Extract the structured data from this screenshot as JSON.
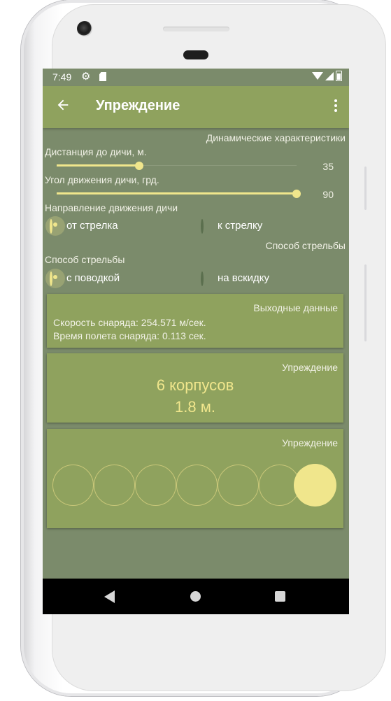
{
  "status": {
    "time": "7:49"
  },
  "appbar": {
    "title": "Упреждение"
  },
  "dynamics": {
    "caption": "Динамические характеристики",
    "distance": {
      "label": "Дистанция до дичи, м.",
      "value": "35",
      "fraction": 0.345
    },
    "angle": {
      "label": "Угол движения дичи, грд.",
      "value": "90",
      "fraction": 1.0
    }
  },
  "direction": {
    "label": "Направление движения дичи",
    "options": [
      {
        "label": "от стрелка",
        "checked": true
      },
      {
        "label": "к стрелку",
        "checked": false
      }
    ]
  },
  "shooting": {
    "caption": "Способ стрельбы",
    "label": "Способ стрельбы",
    "options": [
      {
        "label": "с поводкой",
        "checked": true
      },
      {
        "label": "на вскидку",
        "checked": false
      }
    ]
  },
  "output": {
    "caption": "Выходные данные",
    "speed": "Скорость снаряда: 254.571 м/сек.",
    "flight_time": "Время полета снаряда: 0.113 сек."
  },
  "lead": {
    "caption": "Упреждение",
    "bodies": "6 корпусов",
    "meters": "1.8 м."
  },
  "lead_visual": {
    "caption": "Упреждение",
    "empty_circles": 6,
    "filled_circles": 1
  },
  "colors": {
    "background": "#7b8b6b",
    "appbar": "#8fa25e",
    "accent": "#f0e68c"
  }
}
